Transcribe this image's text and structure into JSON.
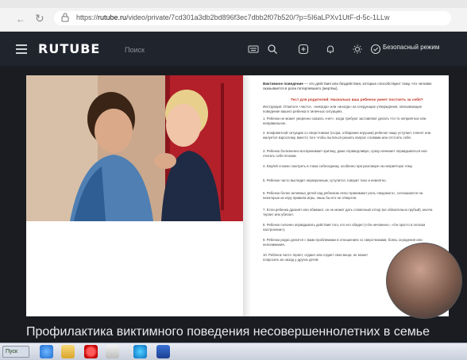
{
  "browser": {
    "url_prefix": "https://",
    "url_domain": "rutube.ru",
    "url_path": "/video/private/7cd301a3db2bd896f3ec7dbb2f07b520/?p=5I6aLPXv1UtF-d-5c-1LLw"
  },
  "header": {
    "logo": "RUTUBE",
    "search_placeholder": "Поиск",
    "safe_mode_label": "Безопасный режим"
  },
  "document": {
    "intro_bold": "Виктимное поведение",
    "intro_text": " — это действия или бездействия, которые способствуют тому, что человек оказывается в роли потерпевшего (жертвы).",
    "section_title": "Тест для родителей: Насколько ваш ребенок умеет постоять за себя?",
    "instruction": "Инструкция: Отметьте «часто», «никогда» или «иногда» на следующие утверждения, описывающие поведение вашего ребенка в типичных ситуациях.",
    "items": [
      "1. Ребенок не может уверенно сказать «нет», когда требуют заставляют делать что-то неприятное или неправильное.",
      "2. Конфликтной ситуации со сверстником (ссора, отбирание игрушки) ребенок чаще уступает, плачет или жалуется взрослому, вместо того чтобы пытаться решить вопрос словами или отстоять себя.",
      "3. Ребенок болезненно воспринимает критику, даже справедливую, сразу начинает оправдываться или считать себя плохим.",
      "4. Ему/ей сложно смотреть в глаза собеседнику, особенно при разговоре на неприятную тему.",
      "5. Ребенок часто выглядит неуверенным, сутулится, говорит тихо и невнятно.",
      "6. Ребенок более активных детей над ребенком легко принимают роль «ведомого», соглашаются на некоторые их игру правила игры, лишь бы его не отвергли.",
      "7. Если ребенка дразнят или обижают, он не может дать словесный отпор (не обязательно грубый), молча терпит или убегает.",
      "8. Ребенок склонен оправдывать действия того, кто его обидел («Он нечаянно», «Он просто в плохом настроении»).",
      "9. Ребенок редко делится с вами проблемами в отношениях со сверстниками, боясь осуждения или непонимания.",
      "10. Ребенок часто теряет, отдают или отдает свои вещи, не может попросить их назад у других детей."
    ]
  },
  "video_title": "Профилактика виктимного поведения несовершеннолетних в семье",
  "taskbar": {
    "start_label": "Пуск"
  }
}
